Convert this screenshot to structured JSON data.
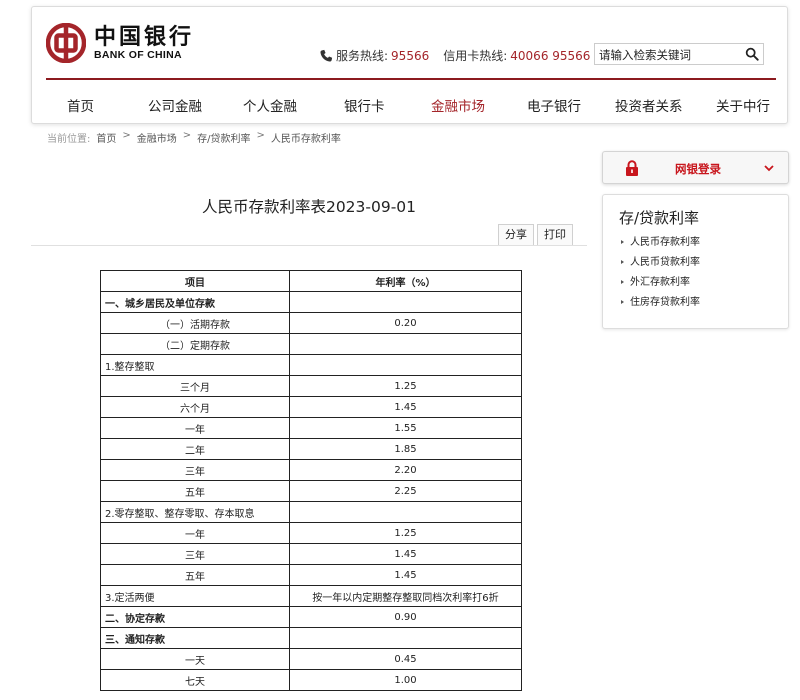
{
  "header": {
    "logo_cn": "中国银行",
    "logo_en": "BANK OF CHINA",
    "service_label": "服务热线:",
    "service_number": "95566",
    "card_label": "信用卡热线:",
    "card_number": "40066 95566",
    "search_placeholder": "请输入检索关键词",
    "brand_color": "#a4252a"
  },
  "nav": {
    "items": [
      "首页",
      "公司金融",
      "个人金融",
      "银行卡",
      "金融市场",
      "电子银行",
      "投资者关系",
      "关于中行"
    ],
    "active": "金融市场"
  },
  "breadcrumb": {
    "lead": "当前位置:",
    "items": [
      "首页",
      "金融市场",
      "存/贷款利率",
      "人民币存款利率"
    ]
  },
  "main": {
    "title": "人民币存款利率表2023-09-01",
    "share_label": "分享",
    "print_label": "打印"
  },
  "table": {
    "headers": [
      "项目",
      "年利率（%）"
    ],
    "rows": [
      [
        "一、城乡居民及单位存款",
        ""
      ],
      [
        "（一）活期存款",
        "0.20"
      ],
      [
        "（二）定期存款",
        ""
      ],
      [
        "1.整存整取",
        ""
      ],
      [
        "三个月",
        "1.25"
      ],
      [
        "六个月",
        "1.45"
      ],
      [
        "一年",
        "1.55"
      ],
      [
        "二年",
        "1.85"
      ],
      [
        "三年",
        "2.20"
      ],
      [
        "五年",
        "2.25"
      ],
      [
        "2.零存整取、整存零取、存本取息",
        ""
      ],
      [
        "一年",
        "1.25"
      ],
      [
        "三年",
        "1.45"
      ],
      [
        "五年",
        "1.45"
      ],
      [
        "3.定活两便",
        "按一年以内定期整存整取同档次利率打6折"
      ],
      [
        "二、协定存款",
        "0.90"
      ],
      [
        "三、通知存款",
        ""
      ],
      [
        "一天",
        "0.45"
      ],
      [
        "七天",
        "1.00"
      ]
    ]
  },
  "sidebar": {
    "login_label": "网银登录",
    "section_title": "存/贷款利率",
    "links": [
      "人民币存款利率",
      "人民币贷款利率",
      "外汇存款利率",
      "住房存贷款利率"
    ]
  }
}
